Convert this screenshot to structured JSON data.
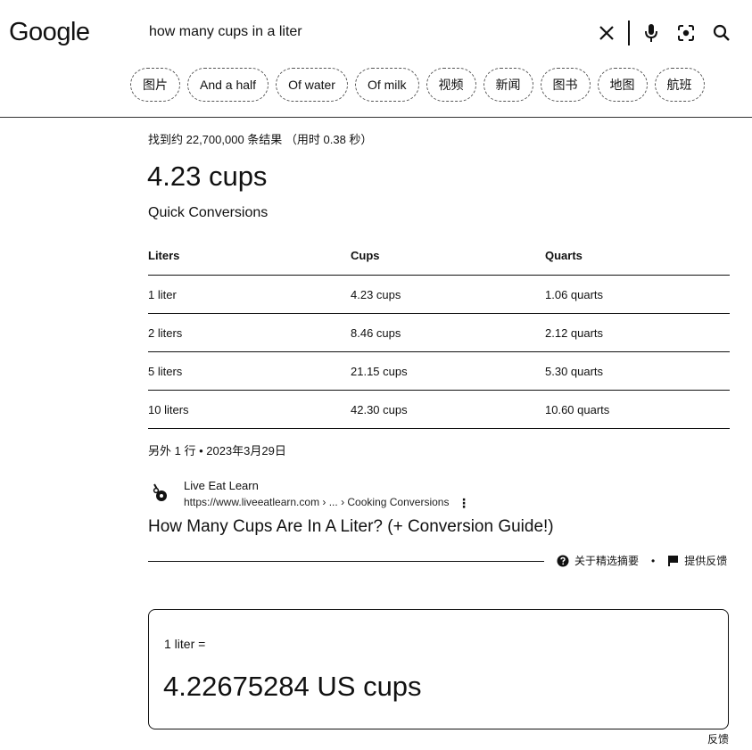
{
  "header": {
    "logo": "Google",
    "query": "how many cups in a liter"
  },
  "icons": {
    "clear": "close-icon",
    "voice": "microphone-icon",
    "lens": "camera-lens-icon",
    "search": "search-icon"
  },
  "chips": [
    "图片",
    "And a half",
    "Of water",
    "Of milk",
    "视频",
    "新闻",
    "图书",
    "地图",
    "航班"
  ],
  "result_stats": "找到约 22,700,000 条结果 （用时 0.38 秒）",
  "featured": {
    "answer": "4.23 cups",
    "subheading": "Quick Conversions",
    "table": {
      "headers": [
        "Liters",
        "Cups",
        "Quarts"
      ],
      "rows": [
        [
          "1 liter",
          "4.23 cups",
          "1.06 quarts"
        ],
        [
          "2 liters",
          "8.46 cups",
          "2.12 quarts"
        ],
        [
          "5 liters",
          "21.15 cups",
          "5.30 quarts"
        ],
        [
          "10 liters",
          "42.30 cups",
          "10.60 quarts"
        ]
      ]
    },
    "more_rows": "另外 1 行 • 2023年3月29日",
    "source": {
      "name": "Live Eat Learn",
      "url": "https://www.liveeatlearn.com › ... › Cooking Conversions",
      "title": "How Many Cups Are In A Liter? (+ Conversion Guide!)"
    },
    "footer": {
      "about": "关于精选摘要",
      "separator": "•",
      "feedback": "提供反馈"
    }
  },
  "converter": {
    "label": "1 liter =",
    "value": "4.22675284 US cups",
    "feedback": "反馈"
  }
}
